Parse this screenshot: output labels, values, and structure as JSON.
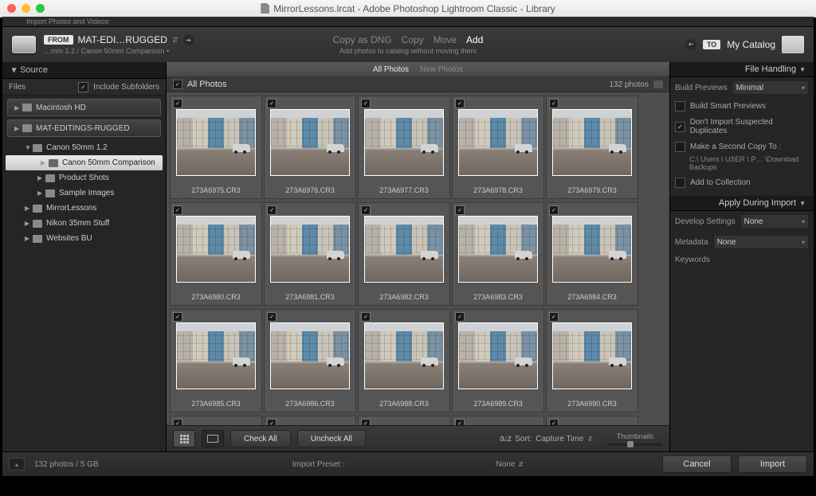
{
  "window_title": "MirrorLessons.lrcat - Adobe Photoshop Lightroom Classic - Library",
  "top_strip_label": "Import Photos and Videos",
  "identity": {
    "from_badge": "FROM",
    "from_name": "MAT-EDI…RUGGED",
    "from_sub": "…mm 1.2 / Canon 50mm Comparison •",
    "to_badge": "TO",
    "to_label": "My Catalog"
  },
  "ops": {
    "items": [
      "Copy as DNG",
      "Copy",
      "Move",
      "Add"
    ],
    "active_index": 3,
    "subtitle": "Add photos to catalog without moving them"
  },
  "source": {
    "header": "Source",
    "files_label": "Files",
    "include_subfolders": "Include Subfolders",
    "tree": [
      {
        "label": "Macintosh HD",
        "type": "drive"
      },
      {
        "label": "MAT-EDITINGS-RUGGED",
        "type": "drive"
      },
      {
        "label": "Canon 50mm 1.2",
        "indent": 1,
        "expanded": true
      },
      {
        "label": "Canon 50mm Comparison",
        "indent": 2,
        "selected": true
      },
      {
        "label": "Product Shots",
        "indent": 2
      },
      {
        "label": "Sample Images",
        "indent": 2
      },
      {
        "label": "MirrorLessons",
        "indent": 1
      },
      {
        "label": "Nikon 35mm Stuff",
        "indent": 1
      },
      {
        "label": "Websites BU",
        "indent": 1
      }
    ]
  },
  "grid": {
    "tabs": [
      "All Photos",
      "New Photos"
    ],
    "active_tab": 0,
    "all_label": "All Photos",
    "count_label": "132 photos",
    "files": [
      "273A6975.CR3",
      "273A6976.CR3",
      "273A6977.CR3",
      "273A6978.CR3",
      "273A6979.CR3",
      "273A6980.CR3",
      "273A6981.CR3",
      "273A6982.CR3",
      "273A6983.CR3",
      "273A6984.CR3",
      "273A6985.CR3",
      "273A6986.CR3",
      "273A6988.CR3",
      "273A6989.CR3",
      "273A6990.CR3"
    ]
  },
  "toolbar": {
    "check_all": "Check All",
    "uncheck_all": "Uncheck All",
    "sort_label": "Sort:",
    "sort_value": "Capture Time",
    "thumbnails_label": "Thumbnails"
  },
  "file_handling": {
    "header": "File Handling",
    "build_label": "Build Previews",
    "build_value": "Minimal",
    "smart": "Build Smart Previews",
    "dupes": "Don't Import Suspected Duplicates",
    "copy_label": "Make a Second Copy To :",
    "copy_path": "C:\\ Users \\ USER \\ P… \\Download Backups",
    "collection": "Add to Collection"
  },
  "apply": {
    "header": "Apply During Import",
    "dev_label": "Develop Settings",
    "dev_value": "None",
    "meta_label": "Metadata",
    "meta_value": "None",
    "keywords_label": "Keywords"
  },
  "footer": {
    "status": "132 photos / 5 GB",
    "preset_label": "Import Preset :",
    "preset_value": "None",
    "cancel": "Cancel",
    "import": "Import"
  }
}
